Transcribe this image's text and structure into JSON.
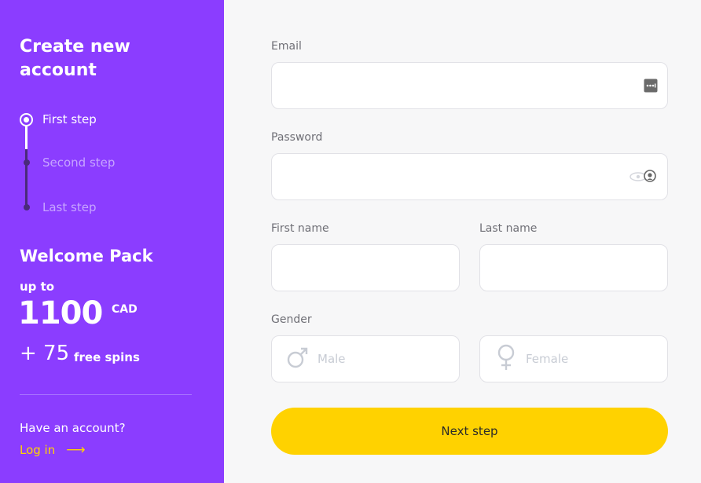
{
  "sidebar": {
    "title": "Create new account",
    "steps": [
      {
        "label": "First step",
        "state": "active"
      },
      {
        "label": "Second step",
        "state": "inactive"
      },
      {
        "label": "Last step",
        "state": "inactive"
      }
    ],
    "welcome_title": "Welcome Pack",
    "up_to": "up to",
    "amount": "1100",
    "currency": "CAD",
    "spins_count": "+ 75",
    "spins_label": "free spins",
    "have_account": "Have an account?",
    "login_label": "Log in",
    "login_arrow": "⟶"
  },
  "form": {
    "email_label": "Email",
    "email_value": "",
    "password_label": "Password",
    "password_value": "",
    "first_name_label": "First name",
    "first_name_value": "",
    "last_name_label": "Last name",
    "last_name_value": "",
    "gender_label": "Gender",
    "gender_options": [
      {
        "label": "Male",
        "icon": "male-icon"
      },
      {
        "label": "Female",
        "icon": "female-icon"
      }
    ],
    "next_label": "Next step"
  },
  "colors": {
    "sidebar_bg": "#8b3dff",
    "accent_yellow": "#ffd200",
    "login_link": "#ffd400"
  }
}
